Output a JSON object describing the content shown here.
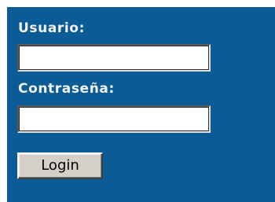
{
  "form": {
    "username_label": "Usuario:",
    "username_value": "",
    "password_label": "Contraseña:",
    "password_value": "",
    "submit_label": "Login"
  },
  "colors": {
    "panel_background": "#0a5b96",
    "label_text": "#f3f3f3",
    "button_face": "#d4d0c8"
  }
}
